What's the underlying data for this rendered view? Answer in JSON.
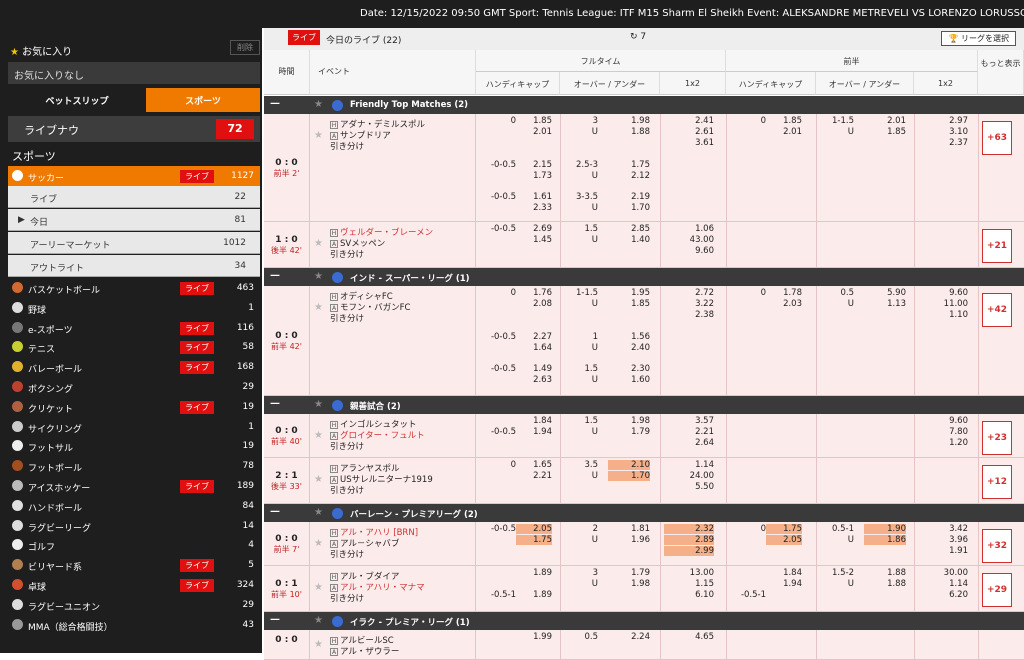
{
  "topbar": {
    "info": "Date: 12/15/2022 09:50 GMT Sport: Tennis League: ITF M15 Sharm El Sheikh Event: ALEKSANDRE METREVELI VS LORENZO LORUSSO Reason f"
  },
  "sidebar": {
    "favorites_title": "お気に入り",
    "delete_label": "削除",
    "no_favorites": "お気に入りなし",
    "tab_betslip": "ベットスリップ",
    "tab_sports": "スポーツ",
    "live_now_label": "ライブナウ",
    "live_now_count": "72",
    "sports_heading": "スポーツ",
    "live_badge": "ライブ",
    "soccer": {
      "name": "サッカー",
      "count": "1127"
    },
    "soccer_sub": [
      {
        "name": "ライブ",
        "count": "22"
      },
      {
        "name": "今日",
        "count": "81"
      },
      {
        "name": "アーリーマーケット",
        "count": "1012"
      },
      {
        "name": "アウトライト",
        "count": "34"
      }
    ],
    "sports": [
      {
        "name": "バスケットボール",
        "live": "ライブ",
        "count": "463",
        "color": "#d06a30"
      },
      {
        "name": "野球",
        "live": "",
        "count": "1",
        "color": "#dddddd"
      },
      {
        "name": "e-スポーツ",
        "live": "ライブ",
        "count": "116",
        "color": "#777777"
      },
      {
        "name": "テニス",
        "live": "ライブ",
        "count": "58",
        "color": "#c8d030"
      },
      {
        "name": "バレーボール",
        "live": "ライブ",
        "count": "168",
        "color": "#e0b030"
      },
      {
        "name": "ボクシング",
        "live": "",
        "count": "29",
        "color": "#c04030"
      },
      {
        "name": "クリケット",
        "live": "ライブ",
        "count": "19",
        "color": "#b06040"
      },
      {
        "name": "サイクリング",
        "live": "",
        "count": "1",
        "color": "#cccccc"
      },
      {
        "name": "フットサル",
        "live": "",
        "count": "19",
        "color": "#eeeeee"
      },
      {
        "name": "フットボール",
        "live": "",
        "count": "78",
        "color": "#a05020"
      },
      {
        "name": "アイスホッケー",
        "live": "ライブ",
        "count": "189",
        "color": "#bbbbbb"
      },
      {
        "name": "ハンドボール",
        "live": "",
        "count": "84",
        "color": "#e0e0e0"
      },
      {
        "name": "ラグビーリーグ",
        "live": "",
        "count": "14",
        "color": "#dddddd"
      },
      {
        "name": "ゴルフ",
        "live": "",
        "count": "4",
        "color": "#eeeeee"
      },
      {
        "name": "ビリヤード系",
        "live": "ライブ",
        "count": "5",
        "color": "#b08050"
      },
      {
        "name": "卓球",
        "live": "ライブ",
        "count": "324",
        "color": "#d05030"
      },
      {
        "name": "ラグビーユニオン",
        "live": "",
        "count": "29",
        "color": "#dddddd"
      },
      {
        "name": "MMA（総合格闘技）",
        "live": "",
        "count": "43",
        "color": "#999999"
      }
    ]
  },
  "main": {
    "live_badge": "ライブ",
    "title": "今日のライブ (22)",
    "refresh": "7",
    "league_select": "リーグを選択",
    "col_time": "時間",
    "col_event": "イベント",
    "fulltime": "フルタイム",
    "firsthalf": "前半",
    "handicap": "ハンディキャップ",
    "overunder": "オーバー / アンダー",
    "onex2": "1x2",
    "more": "もっと表示",
    "leagues": [
      {
        "name": "Friendly Top Matches (2)"
      },
      {
        "name": "インド - スーパー・リーグ (1)"
      },
      {
        "name": "親善試合 (2)"
      },
      {
        "name": "バーレーン - プレミアリーグ (2)"
      },
      {
        "name": "イラク - プレミア・リーグ (1)"
      }
    ],
    "matches": [
      {
        "score": "0 : 0",
        "time": "前半 2'",
        "home": "アダナ・デミルスポル",
        "away": "サンプドリア",
        "draw": "引き分け",
        "more": "+63"
      },
      {
        "score": "1 : 0",
        "time": "後半 42'",
        "home": "ヴェルダー・ブレーメン",
        "away": "SVメッペン",
        "draw": "引き分け",
        "more": "+21"
      },
      {
        "score": "0 : 0",
        "time": "前半 42'",
        "home": "オディシャFC",
        "away": "モフン・バガンFC",
        "draw": "引き分け",
        "more": "+42"
      },
      {
        "score": "0 : 0",
        "time": "前半 40'",
        "home": "インゴルシュタット",
        "away": "グロイター・フュルト",
        "draw": "引き分け",
        "more": "+23"
      },
      {
        "score": "2 : 1",
        "time": "後半 33'",
        "home": "アランヤスポル",
        "away": "USサレルニターナ1919",
        "draw": "引き分け",
        "more": "+12"
      },
      {
        "score": "0 : 0",
        "time": "前半 7'",
        "home": "アル・アハリ [BRN]",
        "away": "アル－シャバブ",
        "draw": "引き分け",
        "more": "+32"
      },
      {
        "score": "0 : 1",
        "time": "前半 10'",
        "home": "アル・ブダイア",
        "away": "アル・アハリ・マナマ",
        "draw": "引き分け",
        "more": "+29"
      },
      {
        "score": "0 : 0",
        "time": "",
        "home": "アルビールSC",
        "away": "アル・ザウラー",
        "draw": "",
        "more": ""
      }
    ],
    "odds": {
      "m1": [
        "0",
        "1.85",
        "2.01",
        "3",
        "U",
        "1.98",
        "1.88",
        "2.41",
        "2.61",
        "3.61",
        "0",
        "1.85",
        "2.01",
        "1-1.5",
        "U",
        "2.01",
        "1.85",
        "2.97",
        "3.10",
        "2.37"
      ],
      "m1a": [
        "-0-0.5",
        "2.15",
        "1.73",
        "2.5-3",
        "U",
        "1.75",
        "2.12"
      ],
      "m1b": [
        "-0-0.5",
        "1.61",
        "2.33",
        "3-3.5",
        "U",
        "2.19",
        "1.70"
      ],
      "m2": [
        "-0-0.5",
        "2.69",
        "1.45",
        "1.5",
        "U",
        "2.85",
        "1.40",
        "1.06",
        "43.00",
        "9.60"
      ],
      "m3": [
        "0",
        "1.76",
        "2.08",
        "1-1.5",
        "U",
        "1.95",
        "1.85",
        "2.72",
        "3.22",
        "2.38",
        "0",
        "1.78",
        "2.03",
        "0.5",
        "U",
        "5.90",
        "1.13",
        "9.60",
        "11.00",
        "1.10"
      ],
      "m3a": [
        "-0-0.5",
        "2.27",
        "1.64",
        "1",
        "U",
        "1.56",
        "2.40"
      ],
      "m3b": [
        "-0-0.5",
        "1.49",
        "2.63",
        "1.5",
        "U",
        "2.30",
        "1.60"
      ],
      "m4": [
        "-0-0.5",
        "1.84",
        "1.94",
        "1.5",
        "U",
        "1.98",
        "1.79",
        "3.57",
        "2.21",
        "2.64",
        "9.60",
        "7.80",
        "1.20"
      ],
      "m5": [
        "0",
        "1.65",
        "2.21",
        "3.5",
        "U",
        "2.10",
        "1.70",
        "1.14",
        "24.00",
        "5.50"
      ],
      "m6": [
        "-0-0.5",
        "2.05",
        "1.75",
        "2",
        "U",
        "1.81",
        "1.96",
        "2.32",
        "2.89",
        "2.99",
        "0",
        "1.75",
        "2.05",
        "0.5-1",
        "U",
        "1.90",
        "1.86",
        "3.42",
        "3.96",
        "1.91"
      ],
      "m7": [
        "-0.5-1",
        "1.89",
        "1.89",
        "3",
        "U",
        "1.79",
        "1.98",
        "13.00",
        "1.15",
        "6.10",
        "-0.5-1",
        "1.84",
        "1.94",
        "1.5-2",
        "U",
        "1.88",
        "1.88",
        "30.00",
        "1.14",
        "6.20"
      ],
      "m8": [
        "1.99",
        "0.5",
        "2.24",
        "4.65"
      ]
    }
  }
}
